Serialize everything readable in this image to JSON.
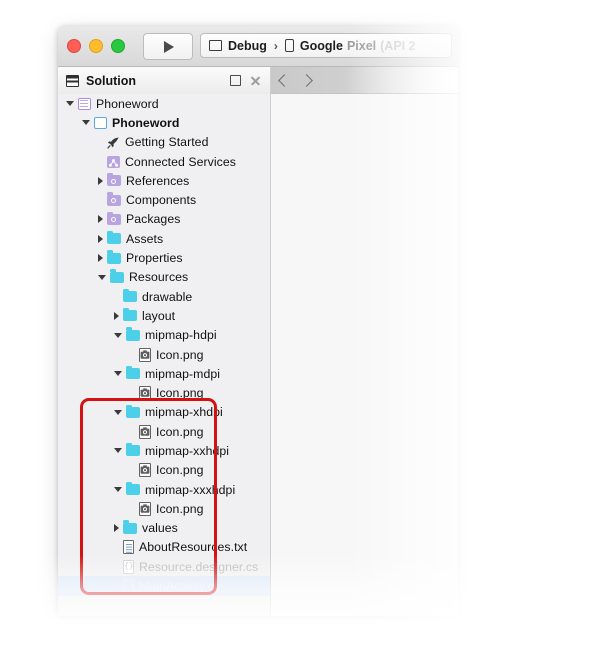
{
  "window": {
    "traffic_lights": [
      "close",
      "minimize",
      "maximize"
    ],
    "run_button_icon": "play-icon",
    "configuration": {
      "config_icon": "monitor-icon",
      "config_label": "Debug",
      "separator": "›",
      "device_icon": "phone-icon",
      "device_label": "Google",
      "device_label_fade1": "Pixel",
      "device_label_fade2": "(API 2"
    }
  },
  "pad": {
    "icon": "solution-pad-icon",
    "title": "Solution",
    "pin_icon": "pin-icon",
    "close_icon": "close-icon",
    "nav_back_icon": "chevron-left-icon",
    "nav_forward_icon": "chevron-right-icon"
  },
  "tree": {
    "nodes": [
      {
        "label": "Phoneword",
        "indent": 0,
        "twisty": "open",
        "icon": "solution-icon",
        "style": "normal"
      },
      {
        "label": "Phoneword",
        "indent": 1,
        "twisty": "open",
        "icon": "project-icon",
        "style": "bold"
      },
      {
        "label": "Getting Started",
        "indent": 2,
        "twisty": "none",
        "icon": "rocket-icon",
        "style": "normal"
      },
      {
        "label": "Connected Services",
        "indent": 2,
        "twisty": "none",
        "icon": "services-icon",
        "style": "normal"
      },
      {
        "label": "References",
        "indent": 2,
        "twisty": "closed",
        "icon": "package-icon",
        "style": "normal"
      },
      {
        "label": "Components",
        "indent": 2,
        "twisty": "none",
        "icon": "package-icon",
        "style": "normal"
      },
      {
        "label": "Packages",
        "indent": 2,
        "twisty": "closed",
        "icon": "package-icon",
        "style": "normal"
      },
      {
        "label": "Assets",
        "indent": 2,
        "twisty": "closed",
        "icon": "folder-icon",
        "style": "normal"
      },
      {
        "label": "Properties",
        "indent": 2,
        "twisty": "closed",
        "icon": "folder-icon",
        "style": "normal"
      },
      {
        "label": "Resources",
        "indent": 2,
        "twisty": "open",
        "icon": "folder-icon",
        "style": "normal"
      },
      {
        "label": "drawable",
        "indent": 3,
        "twisty": "none",
        "icon": "folder-icon",
        "style": "normal"
      },
      {
        "label": "layout",
        "indent": 3,
        "twisty": "closed",
        "icon": "folder-icon",
        "style": "normal"
      },
      {
        "label": "mipmap-hdpi",
        "indent": 3,
        "twisty": "open",
        "icon": "folder-icon",
        "style": "normal"
      },
      {
        "label": "Icon.png",
        "indent": 4,
        "twisty": "none",
        "icon": "png-icon",
        "style": "normal"
      },
      {
        "label": "mipmap-mdpi",
        "indent": 3,
        "twisty": "open",
        "icon": "folder-icon",
        "style": "normal"
      },
      {
        "label": "Icon.png",
        "indent": 4,
        "twisty": "none",
        "icon": "png-icon",
        "style": "normal"
      },
      {
        "label": "mipmap-xhdpi",
        "indent": 3,
        "twisty": "open",
        "icon": "folder-icon",
        "style": "normal"
      },
      {
        "label": "Icon.png",
        "indent": 4,
        "twisty": "none",
        "icon": "png-icon",
        "style": "normal"
      },
      {
        "label": "mipmap-xxhdpi",
        "indent": 3,
        "twisty": "open",
        "icon": "folder-icon",
        "style": "normal"
      },
      {
        "label": "Icon.png",
        "indent": 4,
        "twisty": "none",
        "icon": "png-icon",
        "style": "normal"
      },
      {
        "label": "mipmap-xxxhdpi",
        "indent": 3,
        "twisty": "open",
        "icon": "folder-icon",
        "style": "normal"
      },
      {
        "label": "Icon.png",
        "indent": 4,
        "twisty": "none",
        "icon": "png-icon",
        "style": "normal"
      },
      {
        "label": "values",
        "indent": 3,
        "twisty": "closed",
        "icon": "folder-icon",
        "style": "normal"
      },
      {
        "label": "AboutResources.txt",
        "indent": 3,
        "twisty": "none",
        "icon": "txt-icon",
        "style": "normal"
      },
      {
        "label": "Resource.designer.cs",
        "indent": 3,
        "twisty": "none",
        "icon": "cs-icon",
        "style": "dim"
      },
      {
        "label": "MainActivity.cs",
        "indent": 3,
        "twisty": "none",
        "icon": "cs-icon-ghost",
        "style": "ghost",
        "selected": true
      }
    ]
  },
  "annotation": {
    "name": "mipmap-folders-highlight",
    "color": "#d31212",
    "covers": [
      "mipmap-hdpi",
      "mipmap-mdpi",
      "mipmap-xhdpi",
      "mipmap-xxhdpi",
      "mipmap-xxxhdpi"
    ]
  }
}
